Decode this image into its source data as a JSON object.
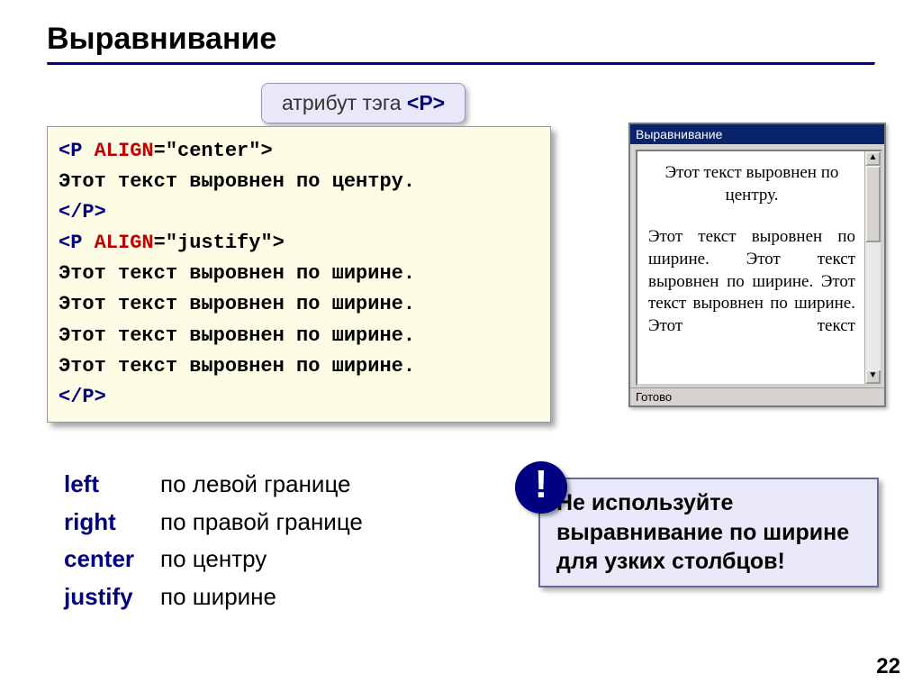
{
  "title": "Выравнивание",
  "callout": {
    "prefix": "атрибут тэга ",
    "tag": "<P>"
  },
  "code": {
    "l1_open": "<P ",
    "l1_attr": "ALIGN",
    "l1_rest": "=\"center\">",
    "l2": "Этот текст выровнен по центру.",
    "l3": "</P>",
    "l4_open": "<P ",
    "l4_attr": "ALIGN",
    "l4_rest": "=\"justify\">",
    "l5": "Этот текст выровнен по ширине.",
    "l6": "Этот текст выровнен по ширине.",
    "l7": "Этот текст выровнен по ширине.",
    "l8": "Этот текст выровнен по ширине.",
    "l9": "</P>"
  },
  "browser": {
    "title": "Выравнивание",
    "center_text": "Этот текст выровнен по центру.",
    "justify_text": "Этот текст выровнен по ширине. Этот текст выровнен по ширине. Этот текст выровнен по ширине. Этот текст",
    "status": "Готово",
    "arrow_up": "▲",
    "arrow_down": "▼"
  },
  "align_options": [
    {
      "key": "left",
      "desc": "по левой границе"
    },
    {
      "key": "right",
      "desc": "по правой границе"
    },
    {
      "key": "center",
      "desc": "по центру"
    },
    {
      "key": "justify",
      "desc": "по ширине"
    }
  ],
  "warning": {
    "bang": "!",
    "text": "Не используйте выравнивание по ширине для узких столбцов!"
  },
  "page_number": "22"
}
